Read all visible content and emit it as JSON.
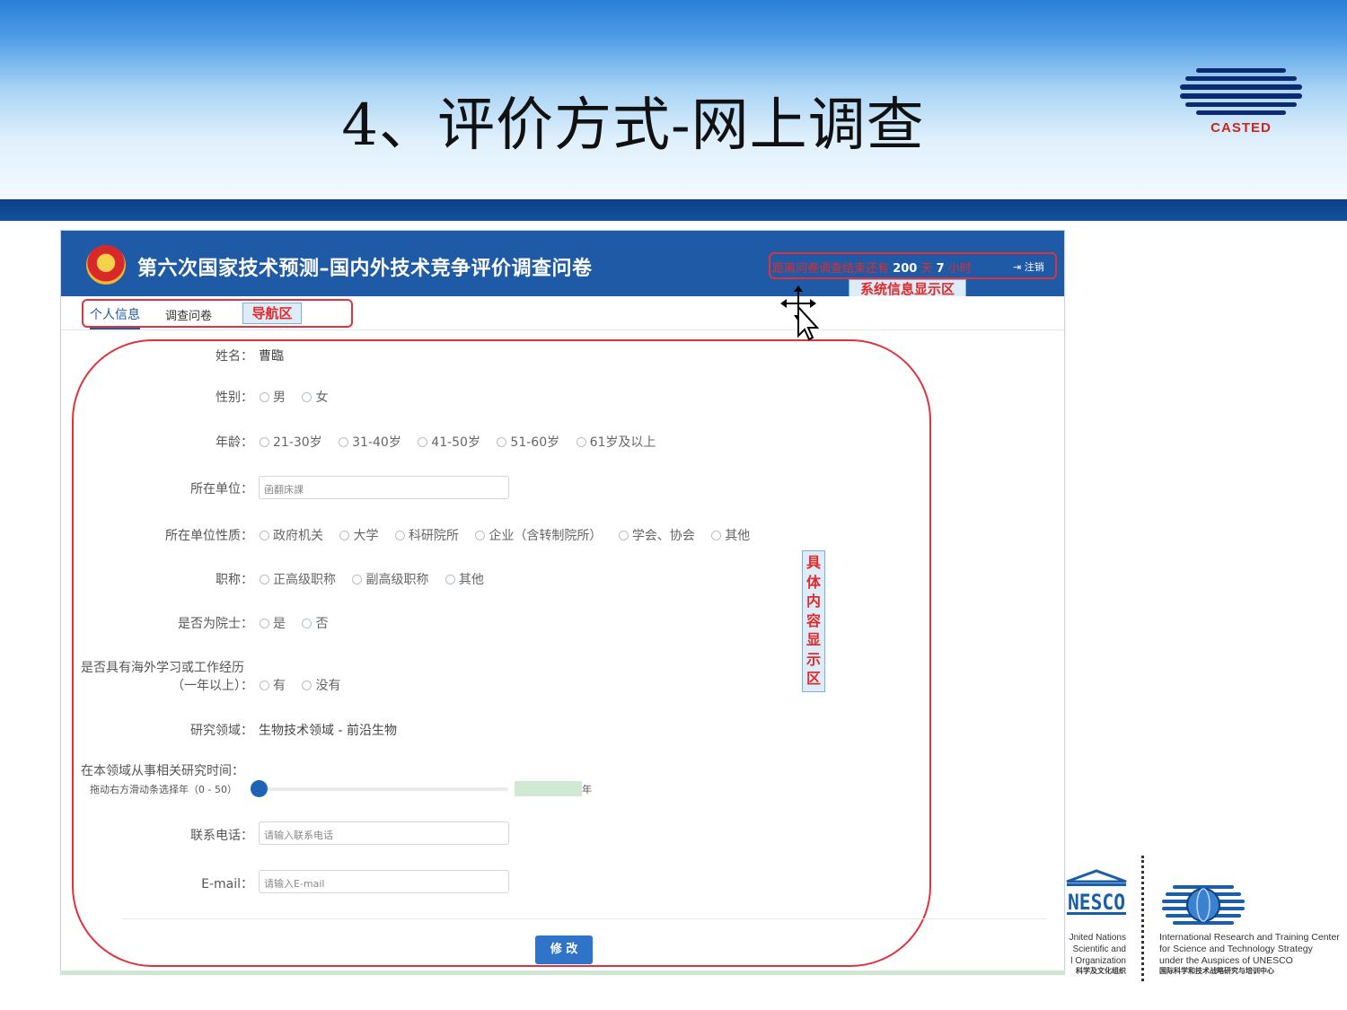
{
  "slide": {
    "title": "4、评价方式-网上调查",
    "logo_text": "CASTED"
  },
  "app": {
    "title": "第六次国家技术预测–国内外技术竞争评价调查问卷",
    "system_info": {
      "prefix": "距离问卷调查结束还有",
      "days": "200",
      "days_unit": "天",
      "hours": "7",
      "hours_unit": "小时",
      "logout_label": "注销"
    },
    "system_info_area_label": "系统信息显示区"
  },
  "nav": {
    "tabs": [
      "个人信息",
      "调查问卷"
    ],
    "area_label": "导航区"
  },
  "form": {
    "name": {
      "label": "姓名：",
      "value": "曹臨"
    },
    "gender": {
      "label": "性别：",
      "options": [
        "男",
        "女"
      ]
    },
    "age": {
      "label": "年龄：",
      "options": [
        "21-30岁",
        "31-40岁",
        "41-50岁",
        "51-60岁",
        "61岁及以上"
      ]
    },
    "unit": {
      "label": "所在单位：",
      "value": "函翻床課"
    },
    "unit_type": {
      "label": "所在单位性质：",
      "options": [
        "政府机关",
        "大学",
        "科研院所",
        "企业（含转制院所）",
        "学会、协会",
        "其他"
      ]
    },
    "title_rank": {
      "label": "职称：",
      "options": [
        "正高级职称",
        "副高级职称",
        "其他"
      ]
    },
    "academician": {
      "label": "是否为院士：",
      "options": [
        "是",
        "否"
      ]
    },
    "overseas": {
      "label_line1": "是否具有海外学习或工作经历",
      "label_line2": "（一年以上）：",
      "options": [
        "有",
        "没有"
      ]
    },
    "research_field": {
      "label": "研究领域：",
      "value": "生物技术领域 - 前沿生物"
    },
    "research_years": {
      "label": "在本领域从事相关研究时间：",
      "hint": "拖动右方滑动条选择年（0 - 50）",
      "value": 0,
      "min": 0,
      "max": 50,
      "unit": "年"
    },
    "phone": {
      "label": "联系电话：",
      "placeholder": "请输入联系电话"
    },
    "email": {
      "label": "E-mail：",
      "placeholder": "请输入E-mail"
    },
    "submit_label": "修 改"
  },
  "content_area_label": "具体内容显示区",
  "footer": {
    "unesco_logo_text": "NESCO",
    "unesco_lines": [
      "Jnited Nations",
      "Scientific and",
      "l Organization"
    ],
    "unesco_cn": "科学及文化组织",
    "irtc_lines": [
      "International Research and Training Center",
      "for Science and Technology Strategy",
      "under the Auspices of UNESCO"
    ],
    "irtc_cn": "国际科学和技术战略研究与培训中心"
  },
  "colors": {
    "header_blue": "#1f5aa6",
    "annotation_red": "#e0323b",
    "accent": "#2f74c9"
  }
}
